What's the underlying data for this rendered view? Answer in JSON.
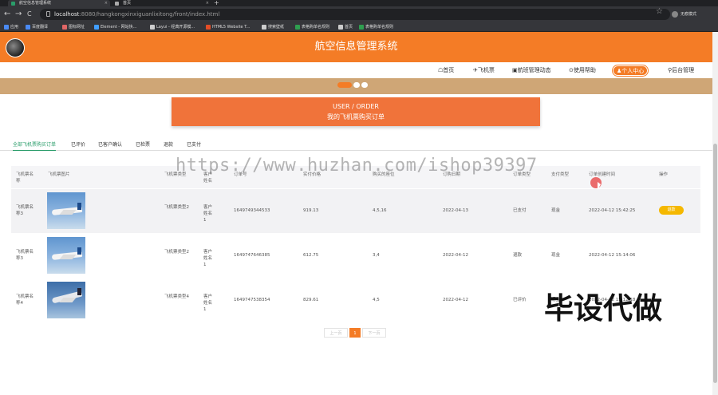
{
  "browser": {
    "tabs": [
      {
        "label": "航空信息管理系统",
        "active": true
      },
      {
        "label": "首页",
        "active": false
      }
    ],
    "new_tab": "+",
    "url_host": "localhost",
    "url_rest": ":8080/hangkongxinxiguanlixitong/front/index.html",
    "nav": {
      "back": "←",
      "forward": "→",
      "reload": "C"
    },
    "star": "☆",
    "profile": "无痕模式",
    "bookmarks": [
      "应用",
      "百度翻译",
      "图标网址",
      "Element - 网站快...",
      "Layui - 经典开源模...",
      "HTML5 Website T...",
      "搜索壁纸",
      "表格购单名规则",
      "首页",
      "表格购单名规则"
    ]
  },
  "site": {
    "title": "航空信息管理系统",
    "nav": [
      {
        "label": "☖首页"
      },
      {
        "label": "✈飞机票"
      },
      {
        "label": "▣航班管理动态"
      },
      {
        "label": "⊙使用帮助"
      },
      {
        "label": "♟个人中心"
      },
      {
        "label": "⚲后台管理"
      }
    ]
  },
  "order_header": {
    "line1": "USER / ORDER",
    "line2": "我的飞机票购买订单"
  },
  "status_tabs": [
    "全部飞机票购买订单",
    "已评价",
    "已客户确认",
    "已检票",
    "退款",
    "已支付"
  ],
  "table": {
    "headers": [
      "飞机票名称",
      "飞机票图片",
      "飞机票类型",
      "客户姓名",
      "订单号",
      "实付价格",
      "购买的座位",
      "订购日期",
      "订单类型",
      "支付类型",
      "订单创建时间",
      "操作"
    ],
    "rows": [
      {
        "name": "飞机票名称3",
        "type": "飞机票类型2",
        "customer": "客户姓名1",
        "order_no": "1649749344533",
        "price": "919.13",
        "seats": "4,5,16",
        "date": "2022-04-13",
        "status": "已支付",
        "pay": "现金",
        "created": "2022-04-12 15:42:25",
        "action": "退款"
      },
      {
        "name": "飞机票名称3",
        "type": "飞机票类型2",
        "customer": "客户姓名1",
        "order_no": "1649747646385",
        "price": "612.75",
        "seats": "3,4",
        "date": "2022-04-12",
        "status": "退款",
        "pay": "现金",
        "created": "2022-04-12 15:14:06",
        "action": ""
      },
      {
        "name": "飞机票名称4",
        "type": "飞机票类型4",
        "customer": "客户姓名1",
        "order_no": "1649747538354",
        "price": "829.61",
        "seats": "4,5",
        "date": "2022-04-12",
        "status": "已评价",
        "pay": "现金",
        "created": "2022-04-12 15:12:18",
        "action": ""
      }
    ]
  },
  "pager": {
    "prev": "上一页",
    "current": "1",
    "next": "下一页"
  },
  "watermark": "https://www.huzhan.com/ishop39397",
  "overlay_text": "毕设代做",
  "colors": {
    "primary": "#f47c26",
    "order_header": "#f0733a",
    "banner": "#cfa676",
    "refund_button": "#f5b800",
    "active_tab": "#2a9d6a"
  }
}
